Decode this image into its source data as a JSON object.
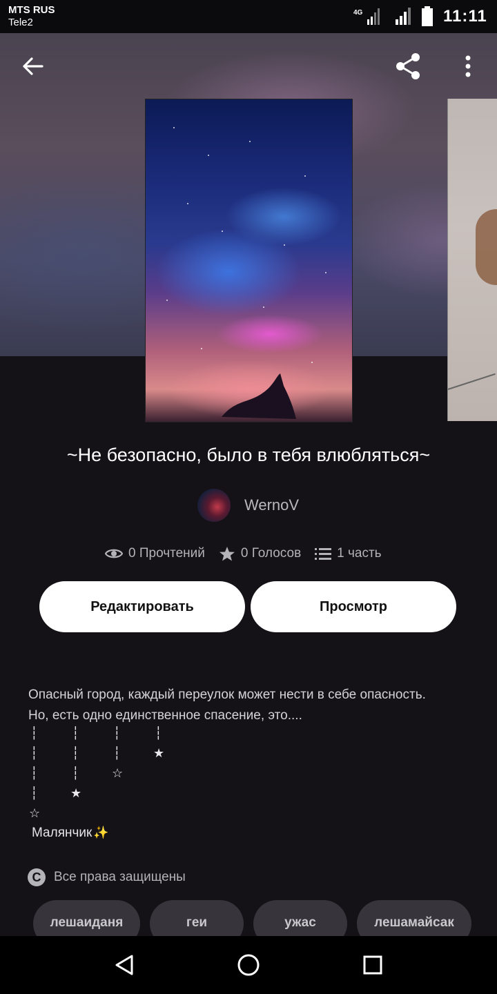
{
  "status_bar": {
    "carrier_primary": "MTS RUS",
    "carrier_secondary": "Tele2",
    "network": "4G",
    "time": "11:11"
  },
  "story": {
    "title": "~Не безопасно, было в тебя влюбляться~",
    "author": "WernoV",
    "stats": {
      "reads": "0 Прочтений",
      "votes": "0 Голосов",
      "parts": "1 часть"
    },
    "buttons": {
      "edit": "Редактировать",
      "view": "Просмотр"
    },
    "description": [
      "Опасный город, каждый переулок может нести в себе опасность.",
      "Но, есть одно единственное спасение, это...."
    ],
    "star_symbols": {
      "dotted_line": "┆",
      "filled_star": "★",
      "outline_star": "☆",
      "sparkles": "✨"
    },
    "signoff": "Малянчик",
    "copyright": "Все права защищены",
    "tags": [
      "лешаиданя",
      "геи",
      "ужас",
      "лешамайсак"
    ]
  },
  "icons": {
    "back": "arrow-left-icon",
    "share": "share-icon",
    "more": "more-vert-icon",
    "reads": "eye-icon",
    "votes": "star-icon",
    "parts": "list-icon",
    "copyright": "copyright-icon"
  }
}
